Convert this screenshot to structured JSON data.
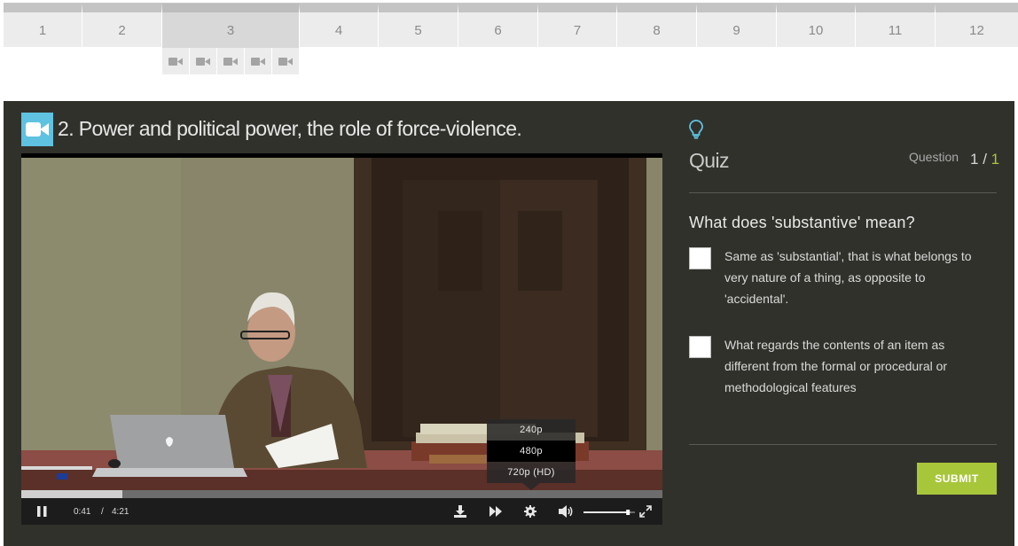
{
  "lesson_nav": {
    "tabs": [
      "1",
      "2",
      "3",
      "4",
      "5",
      "6",
      "7",
      "8",
      "9",
      "10",
      "11",
      "12"
    ],
    "active_index": 2,
    "units": [
      "video-icon",
      "video-icon",
      "video-icon",
      "video-icon",
      "video-icon"
    ]
  },
  "video": {
    "badge_icon": "video-camera-icon",
    "title": "2. Power and political power, the role of force-violence.",
    "current_time": "0:41",
    "time_separator": "/",
    "duration": "4:21",
    "progress_fraction": 0.157,
    "volume_fraction": 0.9,
    "quality_options": [
      "240p",
      "480p",
      "720p (HD)"
    ],
    "selected_quality": "480p",
    "controls": [
      "pause-icon",
      "download-icon",
      "fast-forward-icon",
      "settings-gear-icon",
      "volume-icon",
      "fullscreen-icon"
    ]
  },
  "quiz": {
    "icon": "lightbulb-icon",
    "title": "Quiz",
    "question_label": "Question",
    "current": "1",
    "counter_separator": " / ",
    "total": "1",
    "question": "What does 'substantive' mean?",
    "answers": [
      "Same as 'substantial', that is what belongs to very nature of a thing, as opposite to 'accidental'.",
      "What regards the contents of an item as different from the formal or procedural or methodological features"
    ],
    "submit_label": "SUBMIT"
  },
  "colors": {
    "panel_bg": "#31312c",
    "accent_blue": "#5ec2e0",
    "accent_green": "#a8c63a"
  }
}
